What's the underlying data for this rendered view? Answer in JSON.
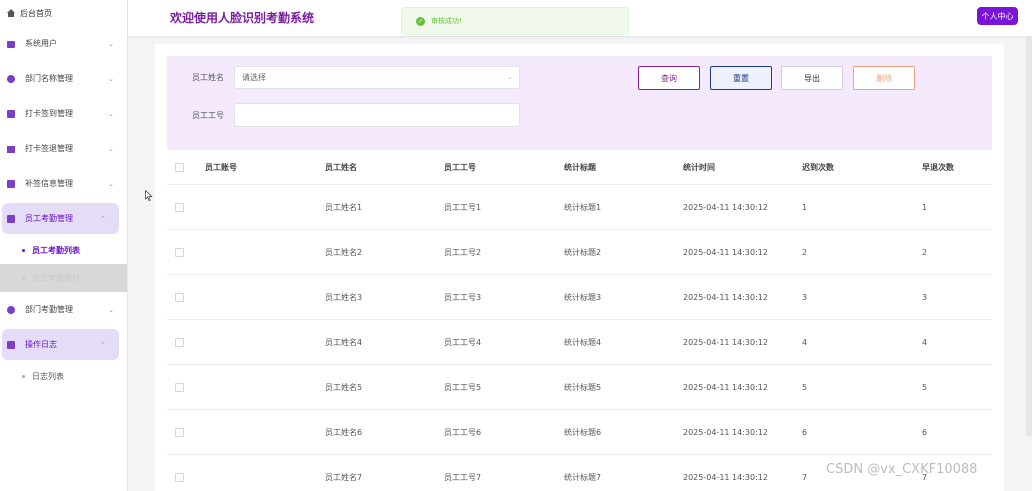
{
  "header": {
    "title": "欢迎使用人脸识别考勤系统",
    "toast": "审核成功!",
    "profile_button": "个人中心"
  },
  "sidebar": {
    "home": "后台首页",
    "items": [
      {
        "label": "系统用户",
        "icon": "user-icon"
      },
      {
        "label": "部门名称管理",
        "icon": "dept-icon"
      },
      {
        "label": "打卡签到管理",
        "icon": "checkin-icon"
      },
      {
        "label": "打卡签退管理",
        "icon": "checkout-icon"
      },
      {
        "label": "补签信息管理",
        "icon": "supplement-icon"
      },
      {
        "label": "员工考勤管理",
        "icon": "attendance-icon",
        "active": true
      },
      {
        "label": "部门考勤管理",
        "icon": "dept-attendance-icon"
      },
      {
        "label": "操作日志",
        "icon": "log-icon",
        "active": true
      }
    ],
    "subs": {
      "employee_list": "员工考勤列表",
      "employee_stats": "员工考勤统计",
      "log_list": "日志列表"
    }
  },
  "search": {
    "name_label": "员工姓名",
    "name_placeholder": "请选择",
    "id_label": "员工工号",
    "id_value": "",
    "buttons": {
      "query": "查询",
      "reset": "重置",
      "export": "导出",
      "delete": "删除"
    }
  },
  "table": {
    "columns": [
      "员工账号",
      "员工姓名",
      "员工工号",
      "统计标题",
      "统计时间",
      "迟到次数",
      "早退次数"
    ],
    "rows": [
      [
        "",
        "员工姓名1",
        "员工工号1",
        "统计标题1",
        "2025-04-11 14:30:12",
        "1",
        "1"
      ],
      [
        "",
        "员工姓名2",
        "员工工号2",
        "统计标题2",
        "2025-04-11 14:30:12",
        "2",
        "2"
      ],
      [
        "",
        "员工姓名3",
        "员工工号3",
        "统计标题3",
        "2025-04-11 14:30:12",
        "3",
        "3"
      ],
      [
        "",
        "员工姓名4",
        "员工工号4",
        "统计标题4",
        "2025-04-11 14:30:12",
        "4",
        "4"
      ],
      [
        "",
        "员工姓名5",
        "员工工号5",
        "统计标题5",
        "2025-04-11 14:30:12",
        "5",
        "5"
      ],
      [
        "",
        "员工姓名6",
        "员工工号6",
        "统计标题6",
        "2025-04-11 14:30:12",
        "6",
        "6"
      ],
      [
        "",
        "员工姓名7",
        "员工工号7",
        "统计标题7",
        "2025-04-11 14:30:12",
        "7",
        "7"
      ]
    ]
  },
  "watermark": "CSDN @vx_CXKF10088",
  "colors": {
    "accent": "#7a14d6",
    "title": "#7a1ea1",
    "search_bg": "#f5e9fd",
    "active_menu": "#e5dcf7",
    "success": "#67c23a"
  }
}
